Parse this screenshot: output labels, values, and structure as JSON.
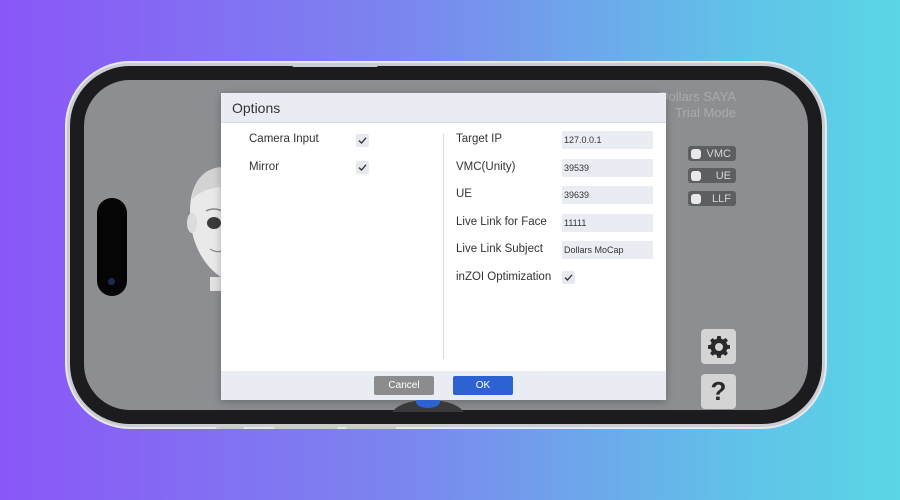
{
  "app": {
    "title_line1": "Dollars SAYA",
    "title_line2": "Trial Mode",
    "toggles": [
      "VMC",
      "UE",
      "LLF"
    ],
    "settings_icon": "gear-icon",
    "help_label": "?"
  },
  "dialog": {
    "title": "Options",
    "left": {
      "camera_input_label": "Camera Input",
      "camera_input_checked": true,
      "mirror_label": "Mirror",
      "mirror_checked": true
    },
    "right": {
      "target_ip_label": "Target IP",
      "target_ip_value": "127.0.0.1",
      "vmc_unity_label": "VMC(Unity)",
      "vmc_unity_value": "39539",
      "ue_label": "UE",
      "ue_value": "39639",
      "live_link_face_label": "Live Link for Face",
      "live_link_face_value": "11111",
      "live_link_subject_label": "Live Link Subject",
      "live_link_subject_value": "Dollars MoCap",
      "inzoi_label": "inZOI Optimization",
      "inzoi_checked": true
    },
    "cancel_label": "Cancel",
    "ok_label": "OK"
  },
  "colors": {
    "accent": "#2d62d3",
    "cancel": "#8c8c8c"
  }
}
